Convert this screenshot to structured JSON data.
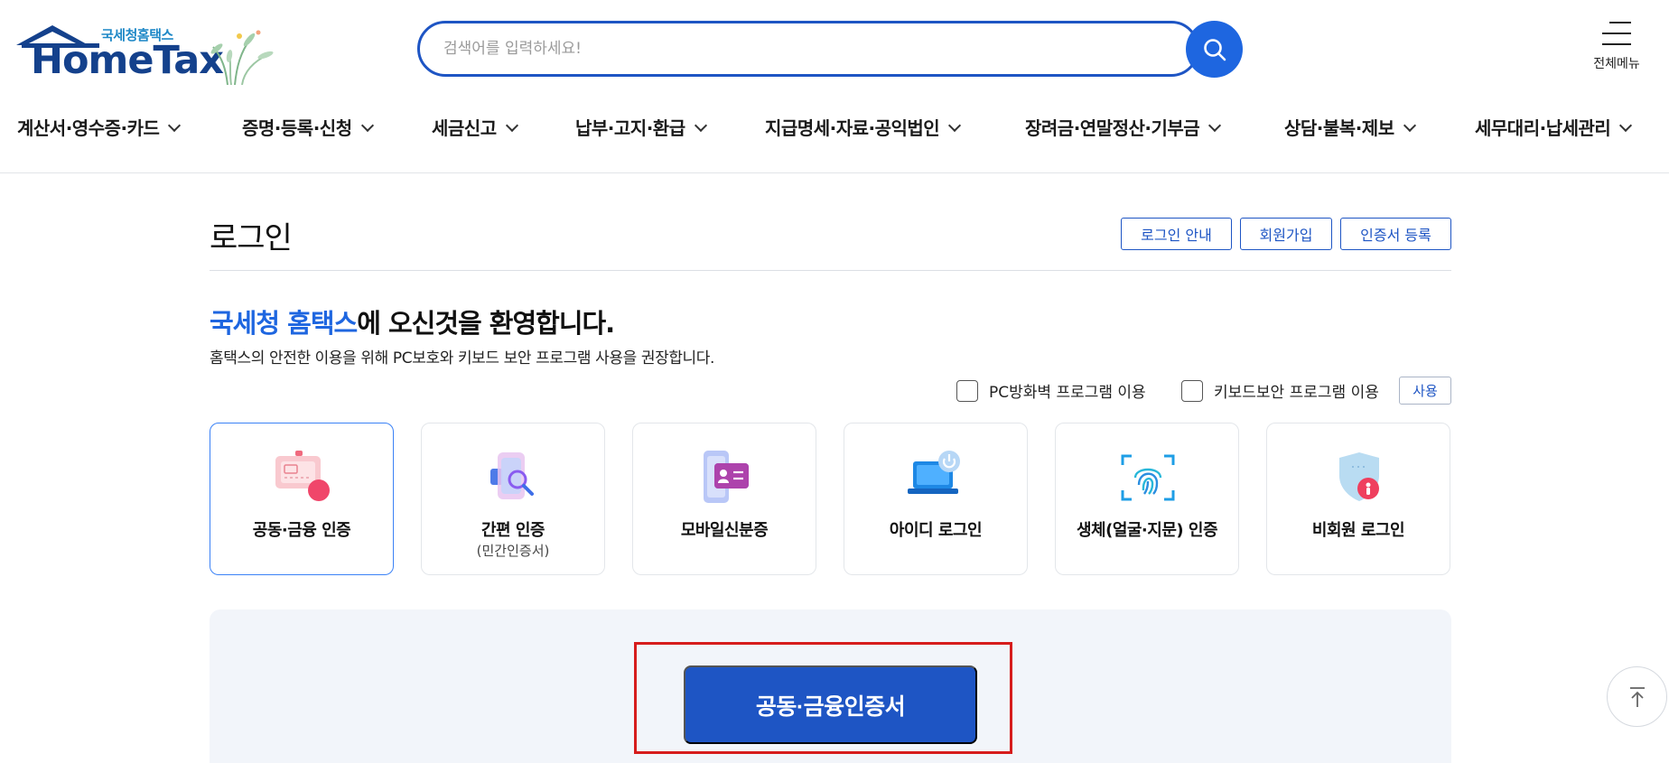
{
  "header": {
    "logo_sub": "국세청홈택스",
    "logo_main": "HomeTax",
    "search_placeholder": "검색어를 입력하세요!",
    "all_menu_label": "전체메뉴"
  },
  "gnb": {
    "items": [
      "계산서·영수증·카드",
      "증명·등록·신청",
      "세금신고",
      "납부·고지·환급",
      "지급명세·자료·공익법인",
      "장려금·연말정산·기부금",
      "상담·불복·제보",
      "세무대리·납세관리"
    ]
  },
  "login": {
    "title": "로그인",
    "buttons": [
      "로그인 안내",
      "회원가입",
      "인증서 등록"
    ],
    "welcome_brand": "국세청 홈택스",
    "welcome_rest": "에 오신것을 환영합니다.",
    "welcome_sub": "홈택스의 안전한 이용을 위해 PC보호와 키보드 보안 프로그램 사용을 권장합니다.",
    "checkbox_firewall": "PC방화벽 프로그램 이용",
    "checkbox_keyboard": "키보드보안 프로그램 이용",
    "use_button": "사용",
    "methods": [
      {
        "label": "공동·금융 인증",
        "sub": "",
        "icon": "certificate-card-icon",
        "selected": true
      },
      {
        "label": "간편 인증",
        "sub": "(민간인증서)",
        "icon": "phone-search-icon",
        "selected": false
      },
      {
        "label": "모바일신분증",
        "sub": "",
        "icon": "mobile-id-icon",
        "selected": false
      },
      {
        "label": "아이디 로그인",
        "sub": "",
        "icon": "laptop-power-icon",
        "selected": false
      },
      {
        "label": "생체(얼굴·지문) 인증",
        "sub": "",
        "icon": "fingerprint-icon",
        "selected": false
      },
      {
        "label": "비회원 로그인",
        "sub": "",
        "icon": "shield-user-icon",
        "selected": false
      }
    ],
    "main_button": "공동·금융인증서"
  },
  "colors": {
    "brand_blue": "#1e55c4",
    "accent_blue": "#1e66e0",
    "highlight_red": "#d61c1c",
    "panel_bg": "#f2f5fa"
  }
}
